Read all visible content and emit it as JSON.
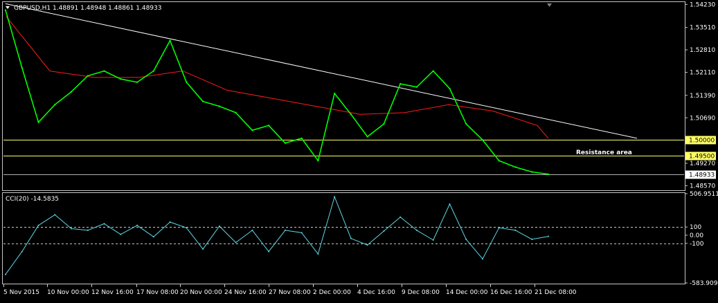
{
  "colors": {
    "background": "#000000",
    "frame": "#c8c8c8",
    "text": "#ffffff",
    "price_line": "#00ff00",
    "moving_average": "#ff1a1a",
    "trendline": "#ffffff",
    "resistance": "#ffff66",
    "current_price_line": "#b4b4b4",
    "price_tag_bg": "#ffff66",
    "current_tag_bg": "#ffffff",
    "cci_line": "#5fd8e6",
    "cci_levels": "#c8c8c8"
  },
  "header": {
    "dropdown_icon": "triangle-down-icon",
    "info": "GBPUSD,H1  1.48891 1.48948 1.48861 1.48933"
  },
  "annotation": "Resistance area",
  "cci_title": "CCI(20) -14.5835",
  "chart_data": [
    {
      "type": "line",
      "title": "GBPUSD,H1",
      "symbol": "GBPUSD",
      "timeframe": "H1",
      "ohlc_last": {
        "open": 1.48891,
        "high": 1.48948,
        "low": 1.48861,
        "close": 1.48933
      },
      "x_tick_labels": [
        "5 Nov 2015",
        "10 Nov 00:00",
        "12 Nov 16:00",
        "17 Nov 08:00",
        "20 Nov 00:00",
        "24 Nov 16:00",
        "27 Nov 08:00",
        "2 Dec 00:00",
        "4 Dec 16:00",
        "9 Dec 08:00",
        "14 Dec 00:00",
        "16 Dec 16:00",
        "21 Dec 08:00"
      ],
      "y_tick_labels": [
        "1.54230",
        "1.53510",
        "1.52810",
        "1.52110",
        "1.51390",
        "1.50690",
        "1.49270",
        "1.48570"
      ],
      "ylim": [
        1.4845,
        1.5428
      ],
      "grid": false,
      "series": [
        {
          "name": "GBPUSD",
          "style": "close",
          "x": [
            "5 Nov 2015",
            "6 Nov",
            "9 Nov",
            "10 Nov 00:00",
            "11 Nov",
            "12 Nov 16:00",
            "13 Nov",
            "16 Nov",
            "17 Nov 08:00",
            "18 Nov",
            "19 Nov",
            "20 Nov 00:00",
            "23 Nov",
            "24 Nov 16:00",
            "25 Nov",
            "26 Nov",
            "27 Nov 08:00",
            "30 Nov",
            "1 Dec",
            "2 Dec 00:00",
            "3 Dec",
            "4 Dec 16:00",
            "7 Dec",
            "8 Dec",
            "9 Dec 08:00",
            "10 Dec",
            "11 Dec",
            "14 Dec 00:00",
            "15 Dec",
            "16 Dec 16:00",
            "17 Dec",
            "18 Dec",
            "21 Dec 08:00",
            "22 Dec"
          ],
          "values": [
            1.5405,
            1.5225,
            1.5055,
            1.511,
            1.515,
            1.52,
            1.5215,
            1.519,
            1.518,
            1.5215,
            1.531,
            1.518,
            1.512,
            1.5105,
            1.5085,
            1.503,
            1.5045,
            1.499,
            1.5005,
            1.4935,
            1.5145,
            1.508,
            1.501,
            1.505,
            1.5175,
            1.5165,
            1.5215,
            1.516,
            1.505,
            1.5,
            1.4935,
            1.4915,
            1.49,
            1.4893
          ]
        },
        {
          "name": "Moving average",
          "style": "ma",
          "x": [
            "5 Nov 2015",
            "10 Nov 00:00",
            "12 Nov 16:00",
            "17 Nov 08:00",
            "20 Nov 00:00",
            "24 Nov 16:00",
            "27 Nov 08:00",
            "2 Dec 00:00",
            "4 Dec 16:00",
            "9 Dec 08:00",
            "14 Dec 00:00",
            "16 Dec 16:00",
            "21 Dec 08:00",
            "22 Dec"
          ],
          "values": [
            1.5385,
            1.5215,
            1.5195,
            1.5195,
            1.5215,
            1.5155,
            1.513,
            1.5105,
            1.508,
            1.5085,
            1.511,
            1.509,
            1.5045,
            1.5005
          ]
        },
        {
          "name": "Trendline",
          "style": "trend",
          "x": [
            "5 Nov 2015",
            "22 Dec"
          ],
          "values": [
            1.5425,
            1.5005
          ]
        }
      ],
      "horizontal_lines": [
        {
          "value": 1.5,
          "label": "1.50000",
          "style": "resistance"
        },
        {
          "value": 1.495,
          "label": "1.49500",
          "style": "resistance"
        },
        {
          "value": 1.48933,
          "label": "1.48933",
          "style": "current"
        }
      ]
    },
    {
      "type": "line",
      "title": "CCI(20) -14.5835",
      "ylim": [
        -583.9094,
        506.9511
      ],
      "y_tick_labels": [
        "506.9511",
        "100",
        "0.00",
        "-100",
        "-583.9094"
      ],
      "levels": [
        100,
        -100
      ],
      "series": [
        {
          "name": "CCI(20)",
          "x": [
            "5 Nov 2015",
            "6 Nov",
            "9 Nov",
            "10 Nov 00:00",
            "11 Nov",
            "12 Nov 16:00",
            "13 Nov",
            "16 Nov",
            "17 Nov 08:00",
            "18 Nov",
            "19 Nov",
            "20 Nov 00:00",
            "23 Nov",
            "24 Nov 16:00",
            "25 Nov",
            "26 Nov",
            "27 Nov 08:00",
            "30 Nov",
            "1 Dec",
            "2 Dec 00:00",
            "3 Dec",
            "4 Dec 16:00",
            "7 Dec",
            "8 Dec",
            "9 Dec 08:00",
            "10 Dec",
            "11 Dec",
            "14 Dec 00:00",
            "15 Dec",
            "16 Dec 16:00",
            "17 Dec",
            "18 Dec",
            "21 Dec 08:00",
            "22 Dec"
          ],
          "values": [
            -480,
            -200,
            120,
            250,
            80,
            60,
            140,
            10,
            120,
            -20,
            160,
            90,
            -170,
            110,
            -90,
            60,
            -200,
            60,
            30,
            -230,
            470,
            -40,
            -120,
            50,
            220,
            60,
            -60,
            380,
            -50,
            -290,
            90,
            60,
            -50,
            -14.5835
          ]
        }
      ]
    }
  ]
}
